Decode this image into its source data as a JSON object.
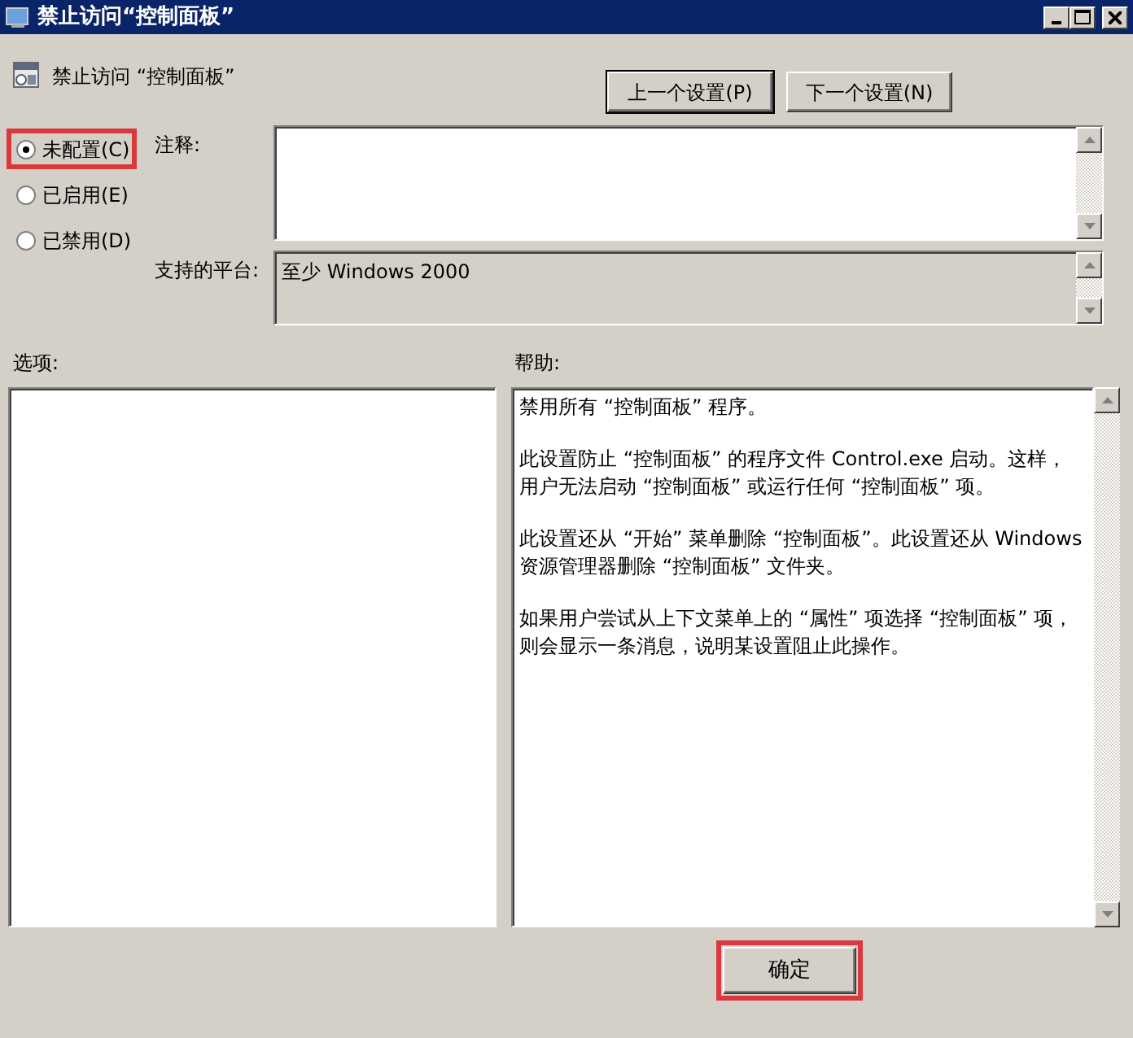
{
  "window": {
    "title": "禁止访问“控制面板”"
  },
  "policy": {
    "name": "禁止访问 “控制面板”"
  },
  "nav_buttons": [
    {
      "label": "上一个设置(P)",
      "focused": true
    },
    {
      "label": "下一个设置(N)",
      "focused": false
    }
  ],
  "state_options": [
    {
      "label": "未配置(C)",
      "selected": true,
      "highlighted": true
    },
    {
      "label": "已启用(E)",
      "selected": false,
      "highlighted": false
    },
    {
      "label": "已禁用(D)",
      "selected": false,
      "highlighted": false
    }
  ],
  "comment": {
    "label": "注释:"
  },
  "platform": {
    "label": "支持的平台:",
    "value": "至少 Windows 2000"
  },
  "options": {
    "label": "选项:"
  },
  "help": {
    "label": "帮助:",
    "paragraphs": [
      "禁用所有 “控制面板” 程序。",
      "此设置防止 “控制面板” 的程序文件 Control.exe 启动。这样，用户无法启动 “控制面板” 或运行任何 “控制面板” 项。",
      "此设置还从 “开始” 菜单删除 “控制面板”。此设置还从 Windows 资源管理器删除 “控制面板” 文件夹。",
      "如果用户尝试从上下文菜单上的 “属性” 项选择 “控制面板” 项，则会显示一条消息，说明某设置阻止此操作。"
    ]
  },
  "ok_button": {
    "label": "确定",
    "highlighted": true
  }
}
